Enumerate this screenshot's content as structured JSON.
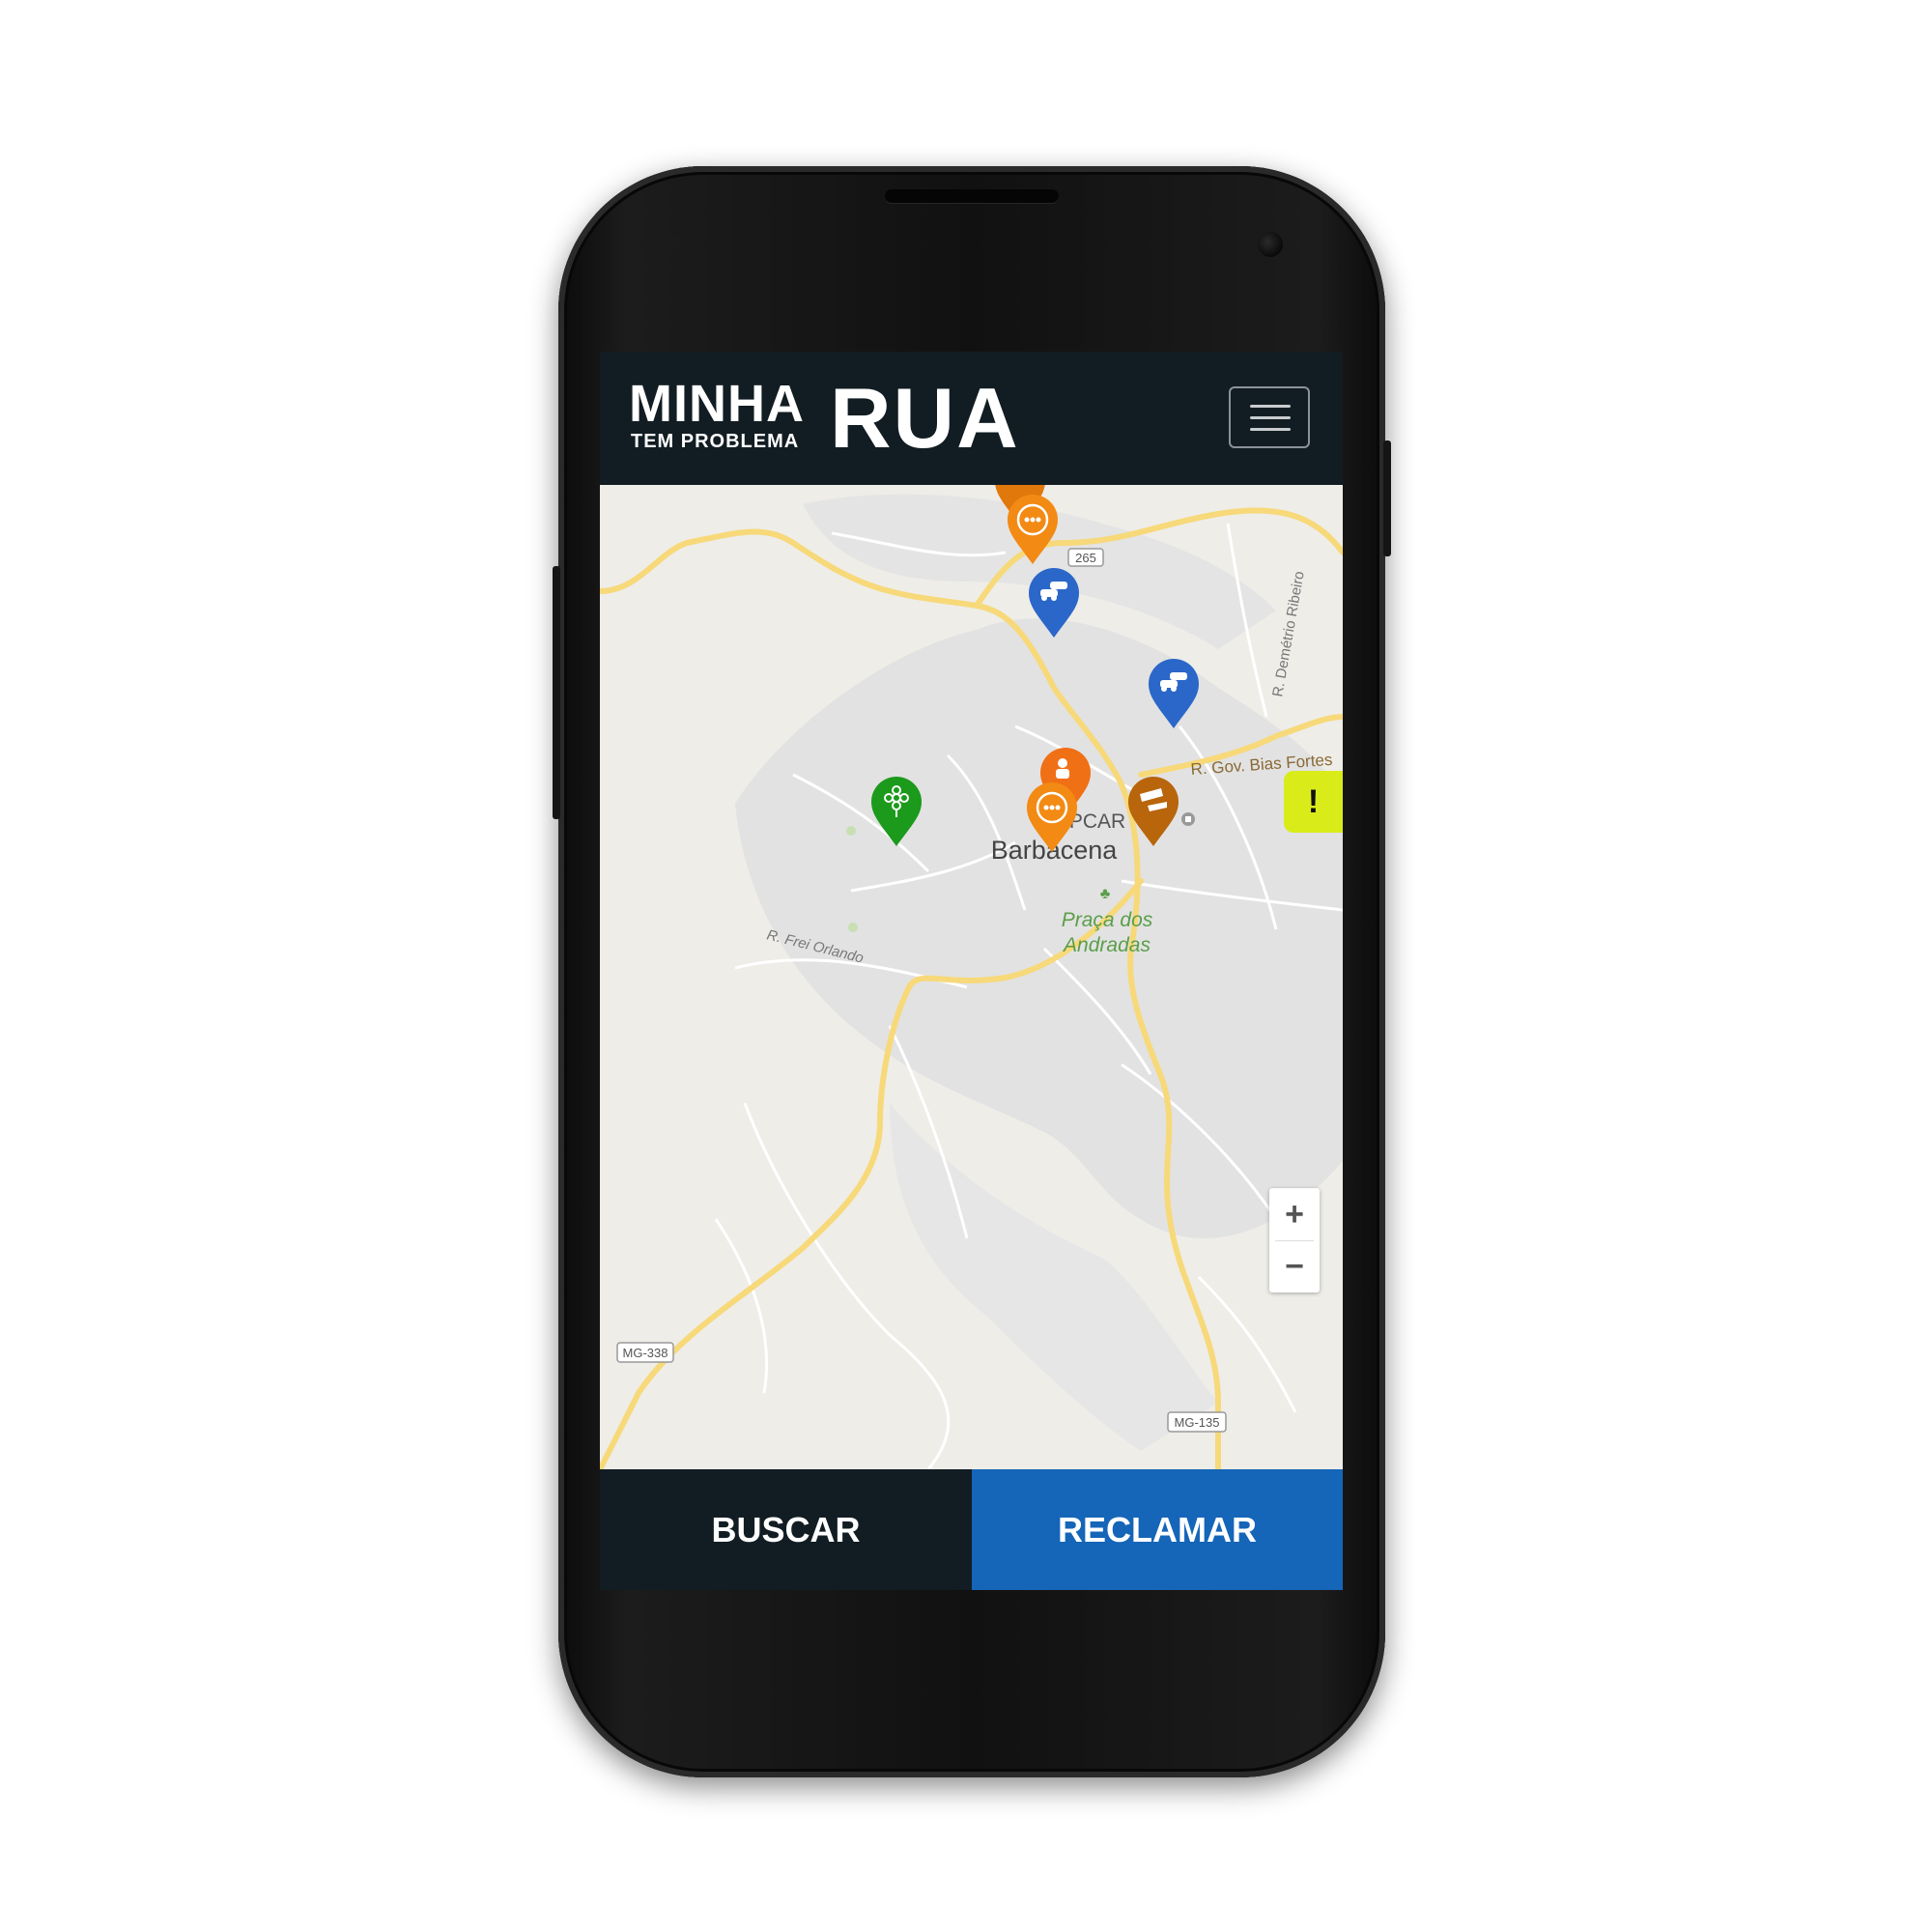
{
  "header": {
    "logo_main": "MINHA",
    "logo_sub": "TEM PROBLEMA",
    "logo_accent": "RUA",
    "menu_icon": "hamburger-icon"
  },
  "map": {
    "city_label": "Barbacena",
    "poi_epcar": "EPCAR",
    "park_line1": "Praça dos",
    "park_line2": "Andradas",
    "street_frei_orlando": "R. Frei Orlando",
    "street_bias_fortes": "R. Gov. Bias Fortes",
    "street_demetrio": "R. Demétrio Ribeiro",
    "route_265": "265",
    "route_mg338": "MG-338",
    "route_mg135": "MG-135",
    "zoom_in": "+",
    "zoom_out": "−",
    "alert_tab": "!",
    "colors": {
      "background": "#eeede8",
      "urban": "#e2e2e2",
      "major_road": "#f7d97a",
      "minor_road": "#ffffff",
      "park": "#c8dfb4"
    },
    "markers": [
      {
        "category": "traffic",
        "color": "#2b67c8",
        "icon": "car-icon"
      },
      {
        "category": "traffic",
        "color": "#2b67c8",
        "icon": "car-icon"
      },
      {
        "category": "environment",
        "color": "#1b9a1b",
        "icon": "flower-icon"
      },
      {
        "category": "other",
        "color": "#f28a14",
        "icon": "ellipsis-icon"
      },
      {
        "category": "other",
        "color": "#f28a14",
        "icon": "ellipsis-icon"
      },
      {
        "category": "person",
        "color": "#f07016",
        "icon": "person-icon"
      },
      {
        "category": "road-damage",
        "color": "#b8650c",
        "icon": "pothole-icon"
      },
      {
        "category": "road-damage",
        "color": "#e0780c",
        "icon": "pothole-icon"
      }
    ]
  },
  "footer": {
    "search_label": "BUSCAR",
    "complain_label": "RECLAMAR",
    "search_color": "#121d23",
    "complain_color": "#1565b8"
  }
}
